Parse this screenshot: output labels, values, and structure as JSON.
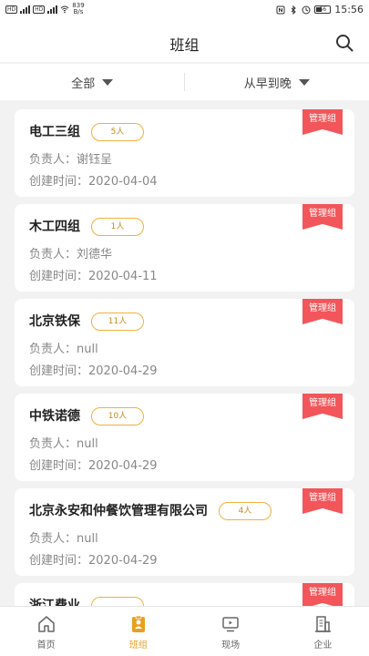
{
  "status_bar": {
    "net_speed_value": "839",
    "net_speed_unit": "B/s",
    "battery": "56",
    "time": "15:56"
  },
  "header": {
    "title": "班组"
  },
  "filters": [
    {
      "label": "全部"
    },
    {
      "label": "从早到晚"
    }
  ],
  "labels": {
    "leader_prefix": "负责人：",
    "created_prefix": "创建时间："
  },
  "teams": [
    {
      "name": "电工三组",
      "count": "5人",
      "leader": "谢钰呈",
      "created": "2020-04-04",
      "ribbon": "管理组"
    },
    {
      "name": "木工四组",
      "count": "1人",
      "leader": "刘德华",
      "created": "2020-04-11",
      "ribbon": "管理组"
    },
    {
      "name": "北京铁保",
      "count": "11人",
      "leader": "null",
      "created": "2020-04-29",
      "ribbon": "管理组"
    },
    {
      "name": "中铁诺德",
      "count": "10人",
      "leader": "null",
      "created": "2020-04-29",
      "ribbon": "管理组"
    },
    {
      "name": "北京永安和仲餐饮管理有限公司",
      "count": "4人",
      "leader": "null",
      "created": "2020-04-29",
      "ribbon": "管理组"
    },
    {
      "name": "浙江费业",
      "count": "",
      "leader": "",
      "created": "",
      "ribbon": "管理组"
    }
  ],
  "tabbar": [
    {
      "label": "首页",
      "icon": "home-icon"
    },
    {
      "label": "班组",
      "icon": "team-icon",
      "active": true
    },
    {
      "label": "现场",
      "icon": "monitor-icon"
    },
    {
      "label": "企业",
      "icon": "building-icon"
    }
  ],
  "colors": {
    "accent": "#e8a020",
    "ribbon": "#f2565a",
    "badge_border": "#f0b040"
  }
}
